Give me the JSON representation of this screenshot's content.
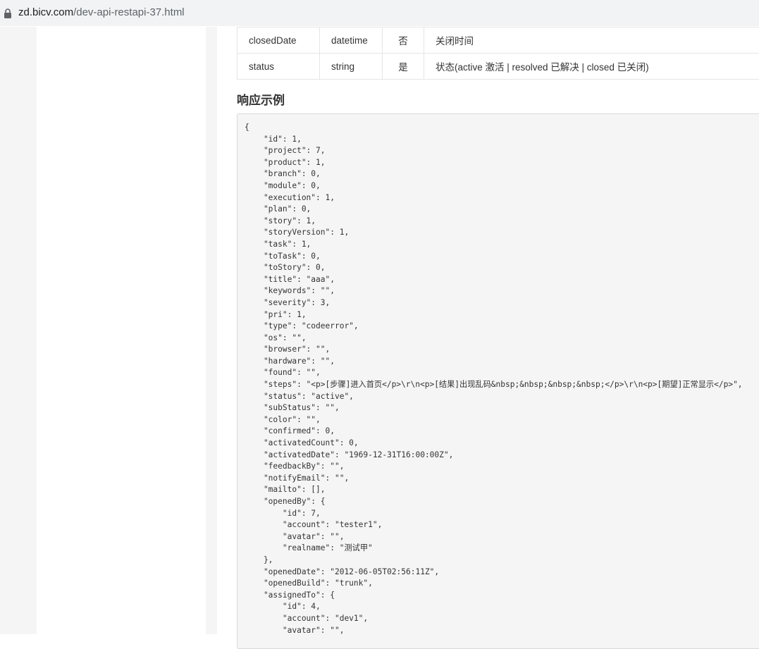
{
  "browser": {
    "url_host": "zd.bicv.com",
    "url_path": "/dev-api-restapi-37.html"
  },
  "params_table": {
    "rows": [
      {
        "name": "closedDate",
        "type": "datetime",
        "required": "否",
        "desc": "关闭时间"
      },
      {
        "name": "status",
        "type": "string",
        "required": "是",
        "desc": "状态(active 激活 | resolved 已解决 | closed 已关闭)"
      }
    ]
  },
  "response_section": {
    "title": "响应示例",
    "code": "{\n    \"id\": 1,\n    \"project\": 7,\n    \"product\": 1,\n    \"branch\": 0,\n    \"module\": 0,\n    \"execution\": 1,\n    \"plan\": 0,\n    \"story\": 1,\n    \"storyVersion\": 1,\n    \"task\": 1,\n    \"toTask\": 0,\n    \"toStory\": 0,\n    \"title\": \"aaa\",\n    \"keywords\": \"\",\n    \"severity\": 3,\n    \"pri\": 1,\n    \"type\": \"codeerror\",\n    \"os\": \"\",\n    \"browser\": \"\",\n    \"hardware\": \"\",\n    \"found\": \"\",\n    \"steps\": \"<p>[步骤]进入首页</p>\\r\\n<p>[结果]出现乱码&nbsp;&nbsp;&nbsp;&nbsp;</p>\\r\\n<p>[期望]正常显示</p>\",\n    \"status\": \"active\",\n    \"subStatus\": \"\",\n    \"color\": \"\",\n    \"confirmed\": 0,\n    \"activatedCount\": 0,\n    \"activatedDate\": \"1969-12-31T16:00:00Z\",\n    \"feedbackBy\": \"\",\n    \"notifyEmail\": \"\",\n    \"mailto\": [],\n    \"openedBy\": {\n        \"id\": 7,\n        \"account\": \"tester1\",\n        \"avatar\": \"\",\n        \"realname\": \"测试甲\"\n    },\n    \"openedDate\": \"2012-06-05T02:56:11Z\",\n    \"openedBuild\": \"trunk\",\n    \"assignedTo\": {\n        \"id\": 4,\n        \"account\": \"dev1\",\n        \"avatar\": \"\","
  },
  "colors": {
    "code_bg": "#f5f5f5",
    "border": "#e5e5e5",
    "text": "#333333",
    "gutter": "#f5f5f5"
  },
  "icons": {
    "lock": "lock-icon"
  }
}
